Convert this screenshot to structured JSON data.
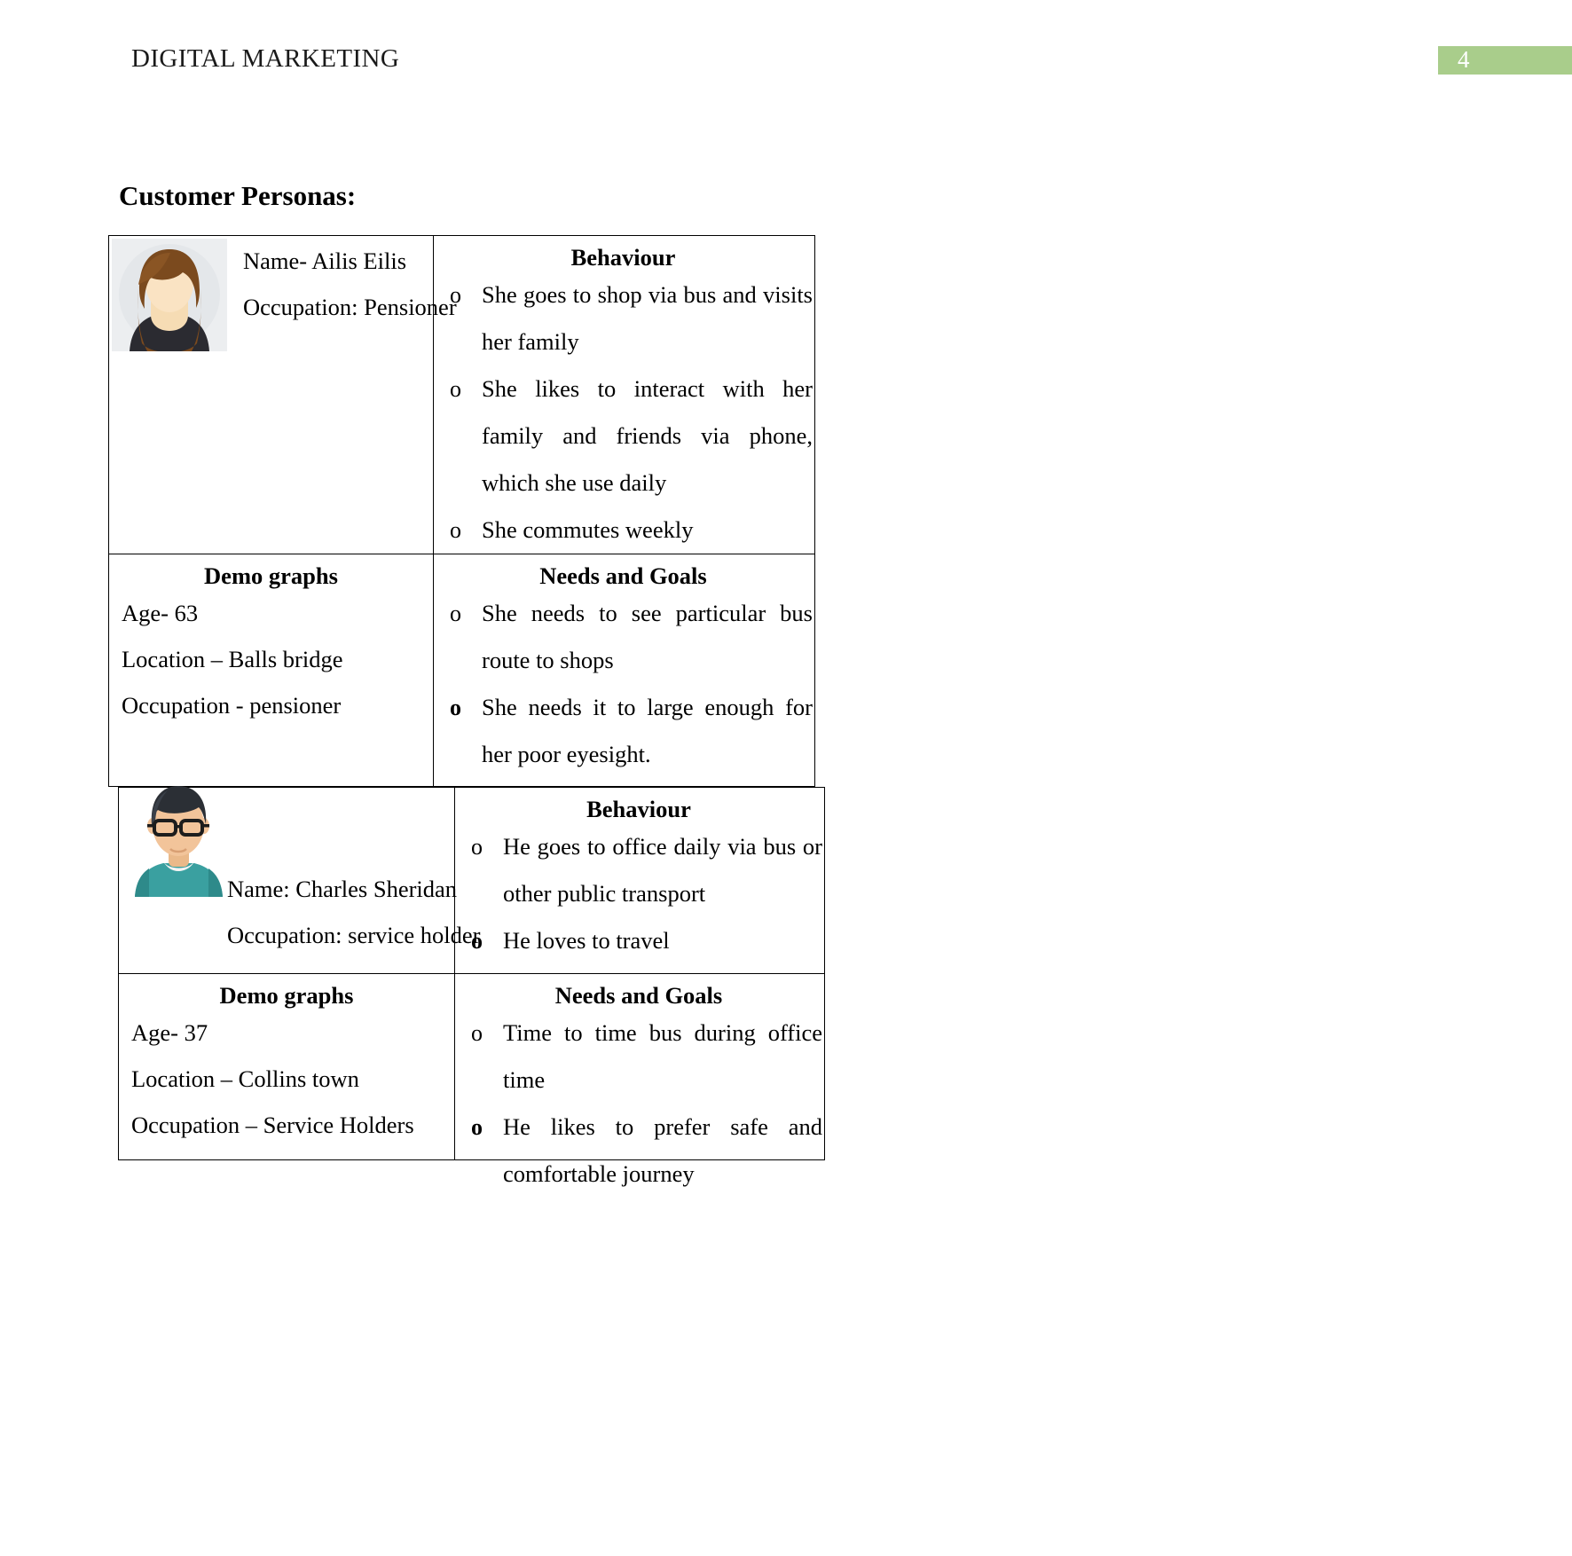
{
  "header": {
    "document_title": "DIGITAL MARKETING",
    "page_number": "4",
    "page_number_bar_color": "#a9cd8b"
  },
  "section": {
    "title": "Customer Personas:"
  },
  "personas": [
    {
      "avatar": "female-avatar-icon",
      "identity": {
        "name_line": "Name- Ailis Eilis",
        "occupation_line": "Occupation: Pensioner"
      },
      "behaviour": {
        "heading": "Behaviour",
        "items": [
          {
            "marker": "o",
            "marker_bold": false,
            "text": "She goes to shop via bus and visits her family"
          },
          {
            "marker": "o",
            "marker_bold": false,
            "text": "She likes to interact with her family and friends via phone, which she use daily"
          },
          {
            "marker": "o",
            "marker_bold": false,
            "text": "She commutes weekly"
          }
        ]
      },
      "demographics": {
        "heading": "Demo graphs",
        "lines": [
          "Age- 63",
          "Location – Balls bridge",
          "Occupation - pensioner"
        ]
      },
      "needs_and_goals": {
        "heading": "Needs and Goals",
        "items": [
          {
            "marker": "o",
            "marker_bold": false,
            "text": "She needs to see particular bus route to shops"
          },
          {
            "marker": "o",
            "marker_bold": true,
            "text": "She needs it to large enough for her poor eyesight."
          }
        ]
      }
    },
    {
      "avatar": "male-avatar-icon",
      "identity": {
        "name_line": "Name: Charles Sheridan",
        "occupation_line": "Occupation: service holder"
      },
      "behaviour": {
        "heading": "Behaviour",
        "items": [
          {
            "marker": "o",
            "marker_bold": false,
            "text": "He goes to office daily via bus or other public transport"
          },
          {
            "marker": "o",
            "marker_bold": true,
            "text": "He loves to travel"
          }
        ]
      },
      "demographics": {
        "heading": "Demo graphs",
        "lines": [
          "Age- 37",
          "Location – Collins town",
          "Occupation – Service Holders"
        ]
      },
      "needs_and_goals": {
        "heading": "Needs and Goals",
        "items": [
          {
            "marker": "o",
            "marker_bold": false,
            "text": "Time to time bus during office time"
          },
          {
            "marker": "o",
            "marker_bold": true,
            "text": "He likes to prefer safe and comfortable journey"
          }
        ]
      }
    }
  ]
}
